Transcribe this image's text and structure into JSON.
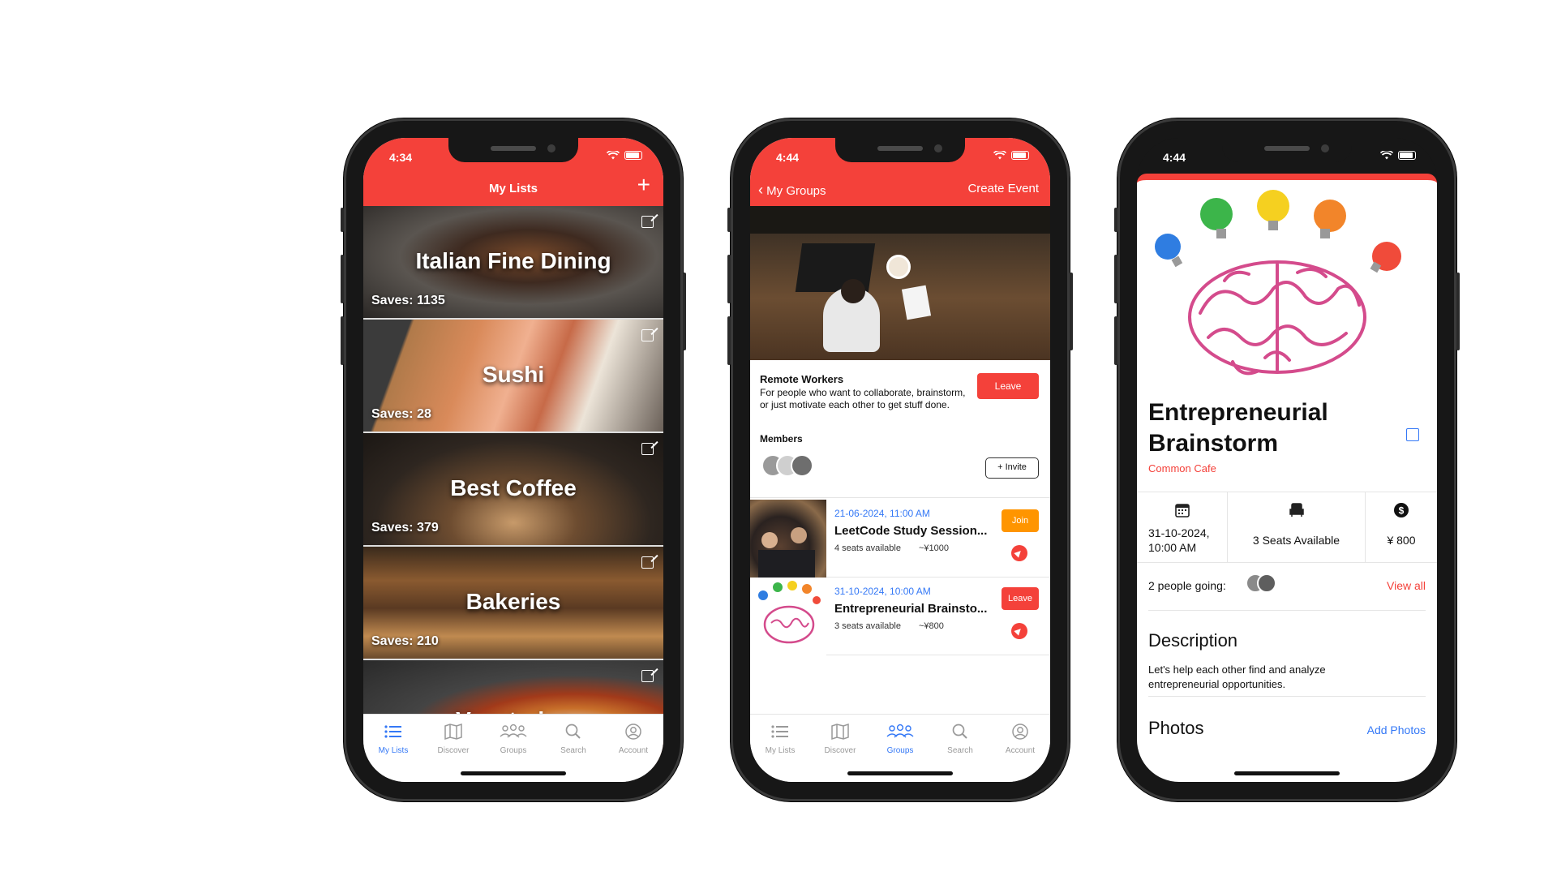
{
  "phone1": {
    "time": "4:34",
    "nav_title": "My Lists",
    "plus": "+",
    "lists": [
      {
        "title": "Italian Fine Dining",
        "saves": "Saves: 1135"
      },
      {
        "title": "Sushi",
        "saves": "Saves: 28"
      },
      {
        "title": "Best Coffee",
        "saves": "Saves: 379"
      },
      {
        "title": "Bakeries",
        "saves": "Saves: 210"
      },
      {
        "title": "Vegetarian",
        "saves": ""
      }
    ],
    "tabs": [
      "My Lists",
      "Discover",
      "Groups",
      "Search",
      "Account"
    ]
  },
  "phone2": {
    "time": "4:44",
    "back_label": "My Groups",
    "right_label": "Create Event",
    "group_name": "Remote Workers",
    "group_desc": "For people who want to collaborate, brainstorm, or just motivate each other to get stuff done.",
    "leave": "Leave",
    "members_label": "Members",
    "invite": "+ Invite",
    "events": [
      {
        "date": "21-06-2024, 11:00 AM",
        "title": "LeetCode Study Session...",
        "seats": "4 seats available",
        "price": "~¥1000",
        "action": "Join",
        "action_color": "#ff9500"
      },
      {
        "date": "31-10-2024, 10:00 AM",
        "title": "Entrepreneurial Brainsto...",
        "seats": "3 seats available",
        "price": "~¥800",
        "action": "Leave",
        "action_color": "#f4413a"
      }
    ],
    "tabs": [
      "My Lists",
      "Discover",
      "Groups",
      "Search",
      "Account"
    ]
  },
  "phone3": {
    "time": "4:44",
    "title": "Entrepreneurial Brainstorm",
    "venue": "Common Cafe",
    "datetime": "31-10-2024,\n10:00 AM",
    "seats": "3 Seats Available",
    "price": "¥ 800",
    "going": "2 people going:",
    "view_all": "View all",
    "description_heading": "Description",
    "description": "Let's help each other find and analyze entrepreneurial opportunities.",
    "photos_heading": "Photos",
    "add_photos": "Add Photos"
  },
  "colors": {
    "accent_red": "#f4413a",
    "link_blue": "#3478f6",
    "join_orange": "#ff9500"
  }
}
